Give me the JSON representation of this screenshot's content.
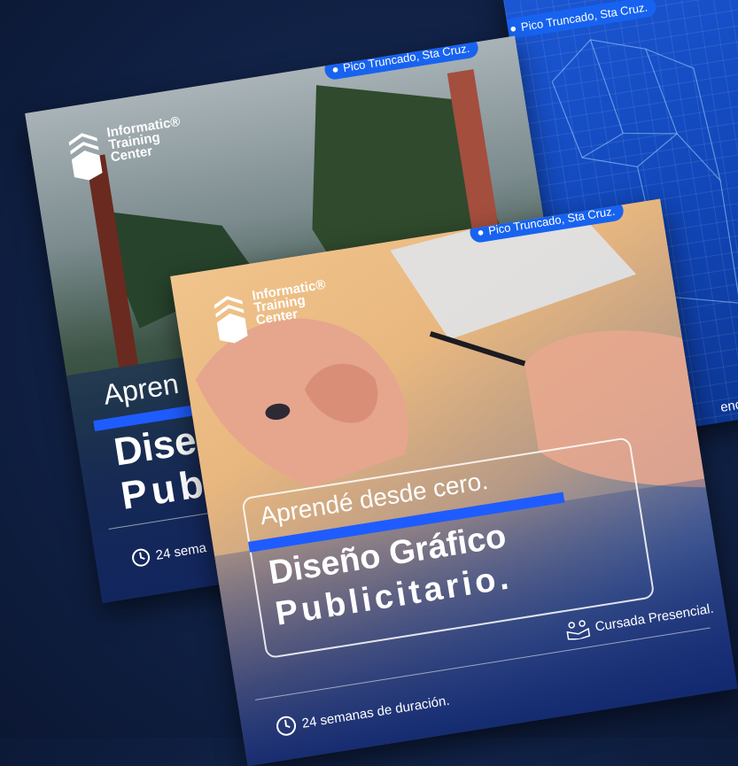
{
  "colors": {
    "accent": "#1f5cff",
    "location_badge": "#1763f0",
    "background": "#12244a"
  },
  "cards": {
    "blueprint": {
      "location": "Pico Truncado, Sta Cruz.",
      "modality_partial": "encial."
    },
    "landscape": {
      "location": "Pico Truncado, Sta Cruz.",
      "brand": [
        "Informatic®",
        "Training",
        "Center"
      ],
      "headline_partial": "Apren",
      "title_line1_partial": "Dise",
      "title_line2_partial": "Pub",
      "duration_partial": "24 sema"
    },
    "front": {
      "location": "Pico Truncado, Sta Cruz.",
      "brand": [
        "Informatic®",
        "Training",
        "Center"
      ],
      "headline": "Aprendé desde cero.",
      "title_line1": "Diseño Gráfico",
      "title_line2": "Publicitario.",
      "duration": "24 semanas de duración.",
      "modality": "Cursada Presencial.",
      "icons": {
        "location": "location-pin-icon",
        "clock": "clock-icon",
        "modality": "people-reading-icon"
      }
    }
  }
}
